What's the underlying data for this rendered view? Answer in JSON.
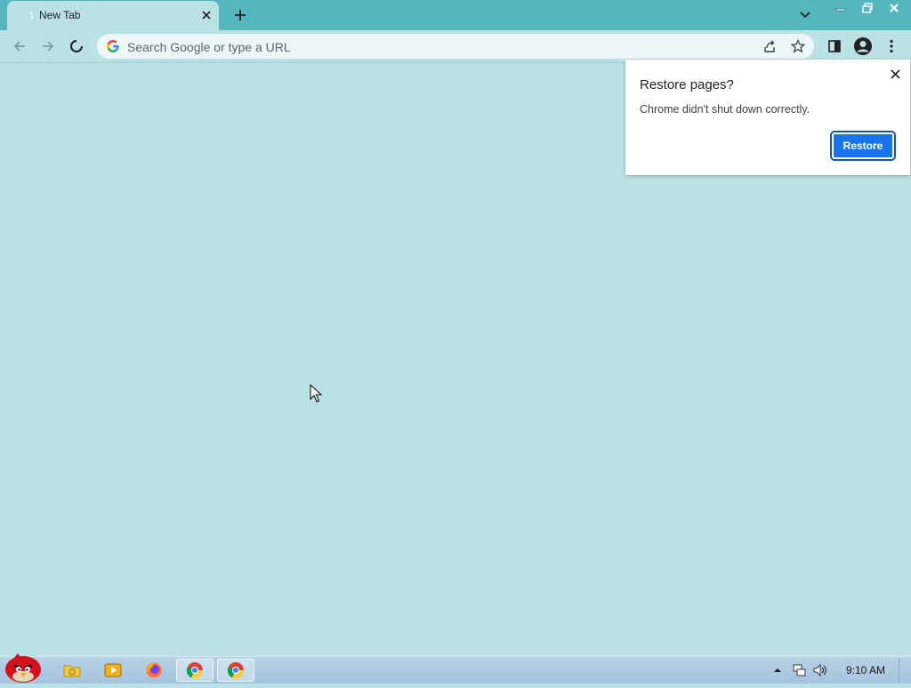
{
  "browser": {
    "tab": {
      "title": "New Tab"
    },
    "omnibox": {
      "placeholder": "Search Google or type a URL",
      "value": ""
    }
  },
  "dialog": {
    "title": "Restore pages?",
    "message": "Chrome didn't shut down correctly.",
    "restore_label": "Restore"
  },
  "taskbar": {
    "apps": [
      "file-explorer",
      "media-player",
      "firefox",
      "chrome",
      "chrome"
    ],
    "clock": "9:10 AM"
  },
  "colors": {
    "frame": "#55b6bd",
    "page": "#bae1e4",
    "accent": "#1a73e8"
  }
}
